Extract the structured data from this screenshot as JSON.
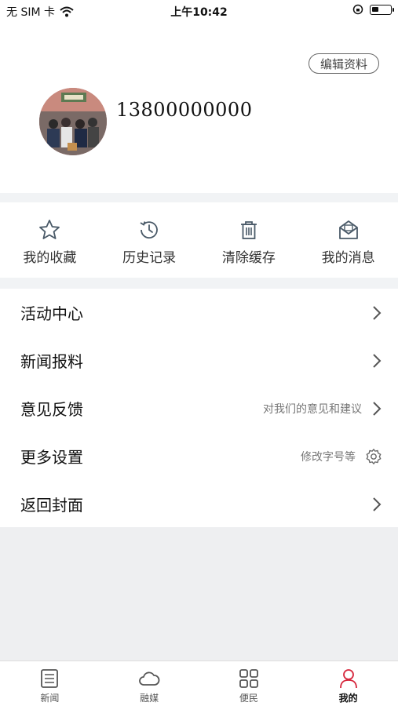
{
  "status_bar": {
    "carrier": "无 SIM 卡",
    "time": "上午10:42",
    "battery_level": 0.35
  },
  "profile": {
    "edit_label": "编辑资料",
    "phone": "13800000000"
  },
  "quick_actions": [
    {
      "label": "我的收藏",
      "icon": "star-icon"
    },
    {
      "label": "历史记录",
      "icon": "history-icon"
    },
    {
      "label": "清除缓存",
      "icon": "trash-icon"
    },
    {
      "label": "我的消息",
      "icon": "mail-icon"
    }
  ],
  "menu": [
    {
      "label": "活动中心",
      "hint": ""
    },
    {
      "label": "新闻报料",
      "hint": ""
    },
    {
      "label": "意见反馈",
      "hint": "对我们的意见和建议"
    },
    {
      "label": "更多设置",
      "hint": "修改字号等"
    },
    {
      "label": "返回封面",
      "hint": ""
    }
  ],
  "tabs": [
    {
      "label": "新闻",
      "icon": "news-icon",
      "active": false
    },
    {
      "label": "融媒",
      "icon": "cloud-icon",
      "active": false
    },
    {
      "label": "便民",
      "icon": "grid-icon",
      "active": false
    },
    {
      "label": "我的",
      "icon": "person-icon",
      "active": true
    }
  ],
  "colors": {
    "accent": "#d6263c",
    "separator": "#f1f3f5",
    "icon": "#4a5a68"
  }
}
